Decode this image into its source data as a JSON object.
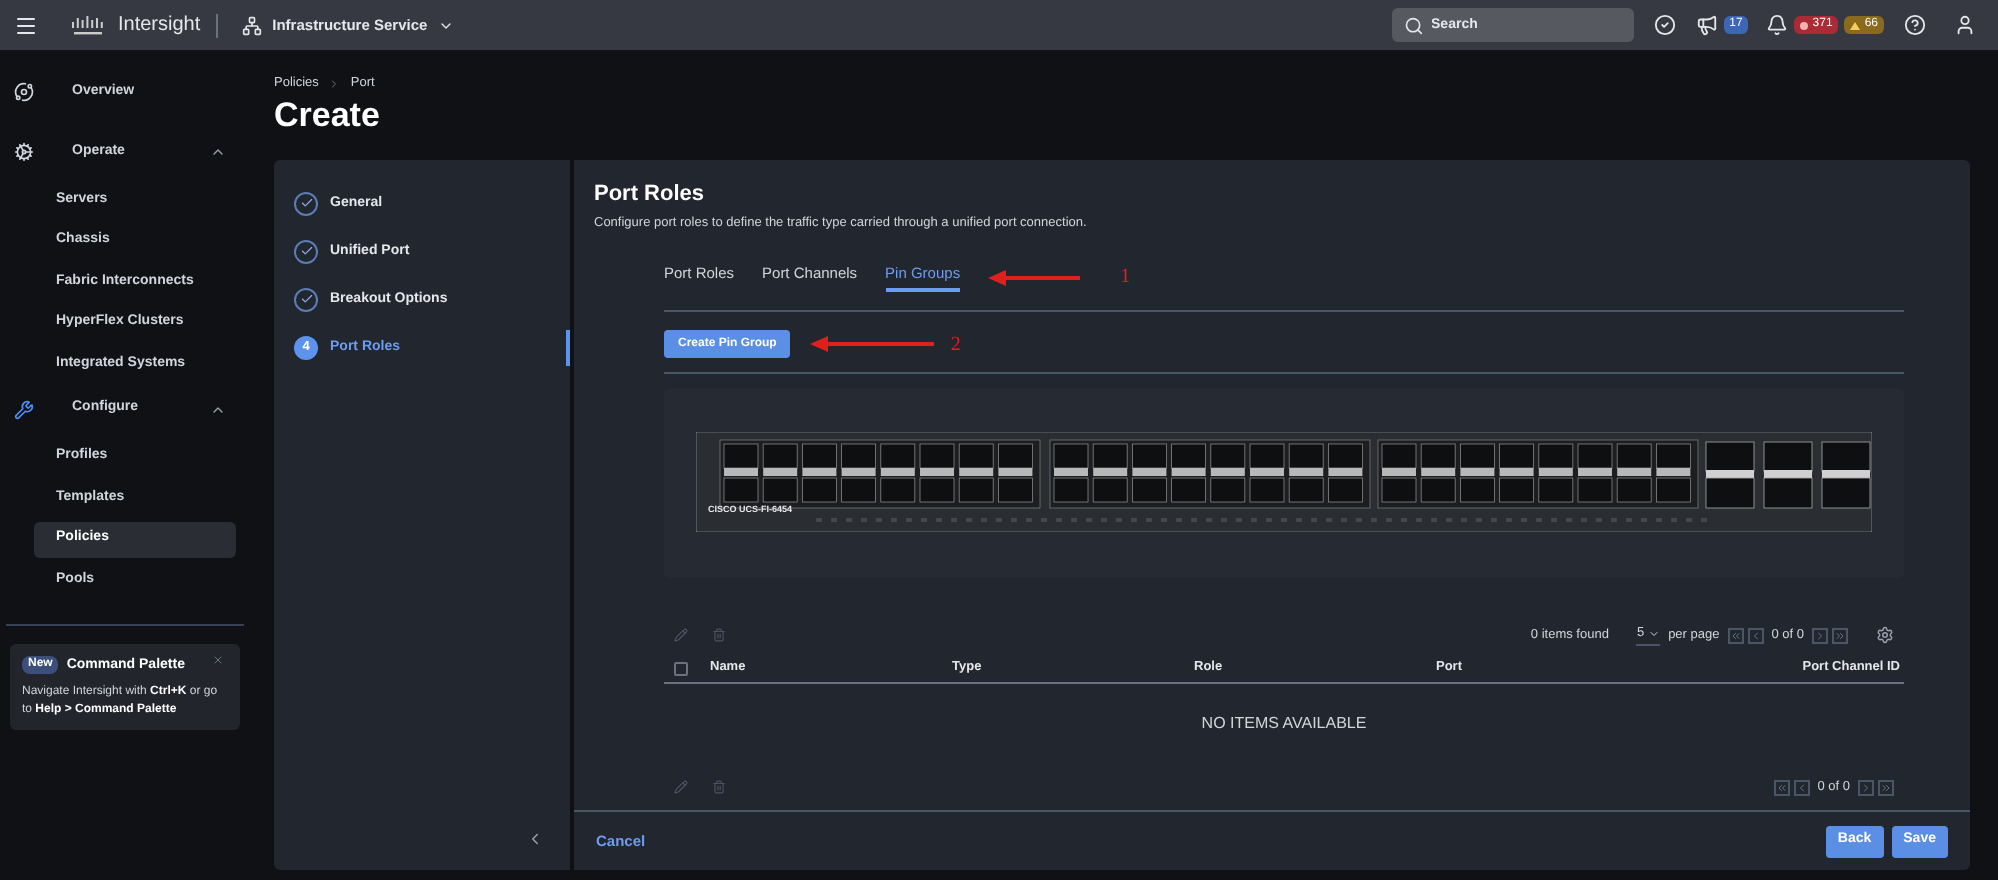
{
  "header": {
    "brand": "Intersight",
    "service": "Infrastructure Service",
    "search": {
      "placeholder": "Search"
    },
    "announcements": "17",
    "alarms_critical": "371",
    "alarms_warning": "66"
  },
  "sidebar": {
    "items": [
      {
        "label": "Overview"
      },
      {
        "label": "Operate",
        "expanded": true,
        "children": [
          {
            "label": "Servers",
            "selected": false
          },
          {
            "label": "Chassis",
            "selected": false
          },
          {
            "label": "Fabric Interconnects",
            "selected": false
          },
          {
            "label": "HyperFlex Clusters",
            "selected": false
          },
          {
            "label": "Integrated Systems",
            "selected": false
          }
        ]
      },
      {
        "label": "Configure",
        "expanded": true,
        "children": [
          {
            "label": "Profiles",
            "selected": false
          },
          {
            "label": "Templates",
            "selected": false
          },
          {
            "label": "Policies",
            "selected": true
          },
          {
            "label": "Pools",
            "selected": false
          }
        ]
      }
    ]
  },
  "command_palette": {
    "badge": "New",
    "title": "Command Palette",
    "text": "Navigate Intersight with **Ctrl+K** or go to **Help > Command Palette**"
  },
  "breadcrumb": [
    "Policies",
    "Port"
  ],
  "page_title": "Create",
  "steps": [
    {
      "label": "General",
      "completed": true,
      "selected": false
    },
    {
      "label": "Unified Port",
      "completed": true,
      "selected": false
    },
    {
      "label": "Breakout Options",
      "completed": true,
      "selected": false
    },
    {
      "label": "Port Roles",
      "completed": false,
      "number": "4",
      "selected": true
    }
  ],
  "section": {
    "title": "Port Roles",
    "description": "Configure port roles to define the traffic type carried through a unified port connection."
  },
  "tabs": [
    {
      "label": "Port Roles",
      "selected": false
    },
    {
      "label": "Port Channels",
      "selected": false
    },
    {
      "label": "Pin Groups",
      "selected": true
    }
  ],
  "annotations": [
    "1",
    "2"
  ],
  "create_button": "Create Pin Group",
  "switch_model": "CISCO UCS-FI-6454",
  "table": {
    "items_found": "0 items found",
    "per_page": "5",
    "per_page_label": "per page",
    "page": "0 of 0",
    "select_all_checked": false,
    "columns": [
      "Name",
      "Type",
      "Role",
      "Port",
      "Port Channel ID"
    ],
    "empty": "NO ITEMS AVAILABLE",
    "bottom_page": "0 of 0"
  },
  "footer": {
    "cancel": "Cancel",
    "back": "Back",
    "save": "Save"
  }
}
